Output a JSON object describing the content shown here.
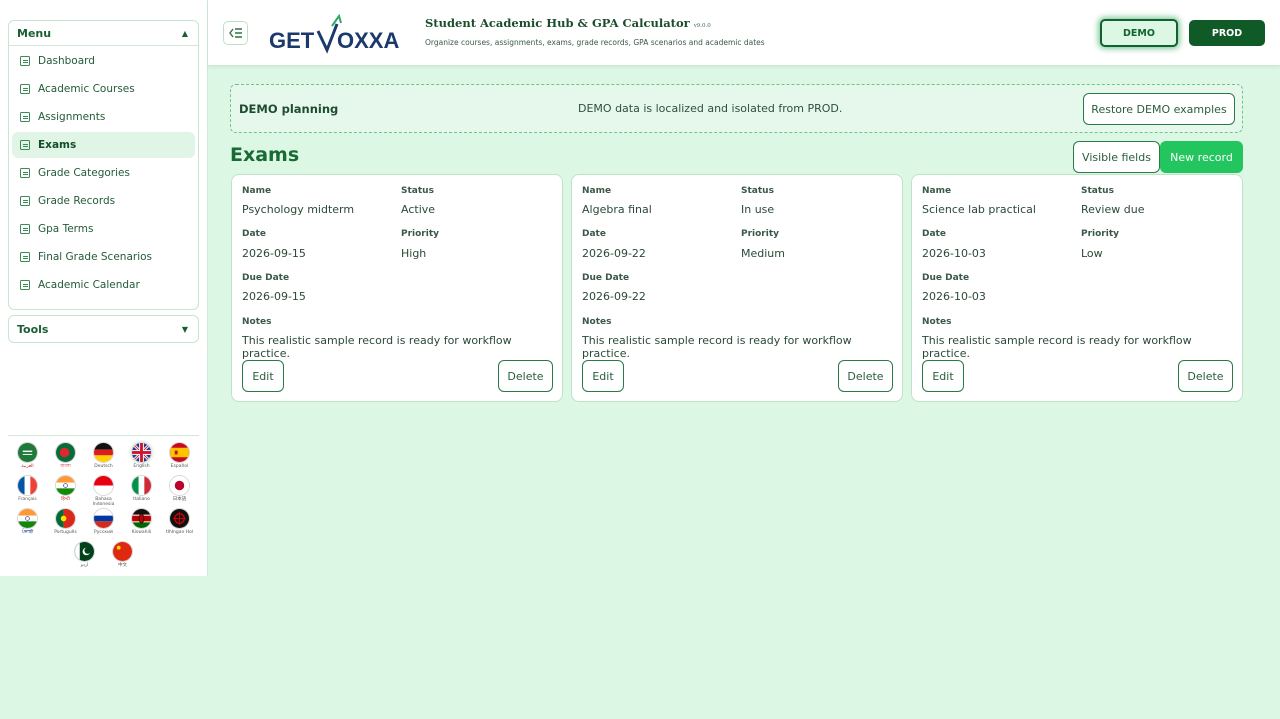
{
  "sidebar": {
    "menu_title": "Menu",
    "items": [
      {
        "label": "Dashboard",
        "active": false
      },
      {
        "label": "Academic Courses",
        "active": false
      },
      {
        "label": "Assignments",
        "active": false
      },
      {
        "label": "Exams",
        "active": true
      },
      {
        "label": "Grade Categories",
        "active": false
      },
      {
        "label": "Grade Records",
        "active": false
      },
      {
        "label": "Gpa Terms",
        "active": false
      },
      {
        "label": "Final Grade Scenarios",
        "active": false
      },
      {
        "label": "Academic Calendar",
        "active": false
      }
    ],
    "tools_title": "Tools",
    "languages": [
      {
        "label": "العربية",
        "flag": "saudi-arabia"
      },
      {
        "label": "বাংলা",
        "flag": "bangladesh"
      },
      {
        "label": "Deutsch",
        "flag": "germany"
      },
      {
        "label": "English",
        "flag": "united-kingdom",
        "selected": true
      },
      {
        "label": "Español",
        "flag": "spain"
      },
      {
        "label": "Français",
        "flag": "france"
      },
      {
        "label": "हिन्दी",
        "flag": "india"
      },
      {
        "label": "Bahasa Indonesia",
        "flag": "indonesia"
      },
      {
        "label": "Italiano",
        "flag": "italy"
      },
      {
        "label": "日本語",
        "flag": "japan"
      },
      {
        "label": "ਪੰਜਾਬੀ",
        "flag": "india"
      },
      {
        "label": "Português",
        "flag": "portugal"
      },
      {
        "label": "Русский",
        "flag": "russia"
      },
      {
        "label": "Kiswahili",
        "flag": "kenya"
      },
      {
        "label": "tlhIngan Hol",
        "flag": "klingon"
      },
      {
        "label": "اردو",
        "flag": "pakistan"
      },
      {
        "label": "中文",
        "flag": "china"
      }
    ]
  },
  "header": {
    "logo_text_left": "GET",
    "logo_text_right": "OXXA",
    "title": "Student Academic Hub & GPA Calculator",
    "version": "v9.0.0",
    "subtitle": "Organize courses, assignments, exams, grade records, GPA scenarios and academic dates",
    "env_demo": "DEMO",
    "env_prod": "PROD"
  },
  "banner": {
    "title": "DEMO planning",
    "text": "DEMO data is localized and isolated from PROD.",
    "restore_label": "Restore DEMO examples"
  },
  "page": {
    "title": "Exams",
    "visible_fields_label": "Visible fields",
    "new_record_label": "New record"
  },
  "labels": {
    "name": "Name",
    "status": "Status",
    "date": "Date",
    "priority": "Priority",
    "due_date": "Due Date",
    "notes": "Notes",
    "edit": "Edit",
    "delete": "Delete"
  },
  "records": [
    {
      "name": "Psychology midterm",
      "status": "Active",
      "date": "2026-09-15",
      "priority": "High",
      "due_date": "2026-09-15",
      "notes": "This realistic sample record is ready for workflow practice."
    },
    {
      "name": "Algebra final",
      "status": "In use",
      "date": "2026-09-22",
      "priority": "Medium",
      "due_date": "2026-09-22",
      "notes": "This realistic sample record is ready for workflow practice."
    },
    {
      "name": "Science lab practical",
      "status": "Review due",
      "date": "2026-10-03",
      "priority": "Low",
      "due_date": "2026-10-03",
      "notes": "This realistic sample record is ready for workflow practice."
    }
  ],
  "colors": {
    "accent": "#22c55e",
    "brand_dark": "#0f5a27",
    "background": "#dcf7e4"
  }
}
